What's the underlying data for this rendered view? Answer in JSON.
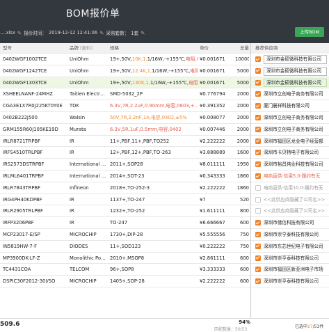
{
  "app": {
    "title": "BOM报价单",
    "file": "….xlsx",
    "time_label": "报价时间：",
    "time_value": "2019-12-12 12:41:06",
    "qty_label": "采购套数：",
    "qty_value": "1套",
    "upload": "上传BOM"
  },
  "table": {
    "headers": [
      "型号",
      "品牌",
      "规格",
      "单价",
      "总量"
    ],
    "brand_tag": "[备料]",
    "rows": [
      {
        "part": "0402WGF1002TCE",
        "brand": "UniOhm",
        "spec": [
          [
            "19+,50V,",
            ""
          ],
          [
            "10K,1,",
            ""
          ],
          [
            "1/16W,-+155℃,",
            ""
          ],
          [
            "电阻,0402",
            ""
          ]
        ],
        "price": "¥0.001671",
        "qty": "10000",
        "sel": false
      },
      {
        "part": "0402WGF1242TCE",
        "brand": "UniOhm",
        "spec": [
          [
            "19+,50V,",
            ""
          ],
          [
            "12.4K,1,",
            ""
          ],
          [
            "1/16W,-+155℃,",
            ""
          ],
          [
            "电阻,0402",
            ""
          ]
        ],
        "price": "¥0.001671",
        "qty": "5000",
        "sel": false
      },
      {
        "part": "0402WGF1303TCE",
        "brand": "UniOhm",
        "spec": [
          [
            "19+,50V,",
            ""
          ],
          [
            "130K,1,",
            ""
          ],
          [
            "1/16W,-+155℃,",
            ""
          ],
          [
            "电阻,0402",
            ""
          ]
        ],
        "price": "¥0.001671",
        "qty": "5000",
        "sel": true
      },
      {
        "part": "XSHEELNANF-24MHZ",
        "brand": "Taitien Electr…",
        "spec": [
          [
            "SMD-5032_2P",
            ""
          ]
        ],
        "price": "¥0.776794",
        "qty": "2000",
        "sel": false
      },
      {
        "part": "CGA3E1X7R0J225KT0Y0E",
        "brand": "TDK",
        "spec": [
          [
            "6.3V,7R,2.2uF,0.90mm,电容,0603,+…",
            ""
          ]
        ],
        "price": "¥0.391352",
        "qty": "2000",
        "sel": false
      },
      {
        "part": "0402B222J500",
        "brand": "Walsin",
        "spec": [
          [
            "50V,7R,2.2nF,1A,电容,0402,±5%",
            ""
          ]
        ],
        "price": "¥0.008077",
        "qty": "2000",
        "sel": false
      },
      {
        "part": "GRM155R60J105KE19D",
        "brand": "Murata",
        "spec": [
          [
            "6.3V,5R,1uF,0.5mm,",
            ""
          ],
          [
            "电容,0402",
            ""
          ]
        ],
        "price": "¥0.007446",
        "qty": "2000",
        "sel": false
      },
      {
        "part": "IRLR8721TRPBF",
        "brand": "IR",
        "spec": [
          [
            "11+,PBF,11+,PBF,TO252",
            ""
          ]
        ],
        "price": "¥2.222222",
        "qty": "2000",
        "sel": false
      },
      {
        "part": "IRFS4510TRLPBF",
        "brand": "IR",
        "spec": [
          [
            "12+,PBF,12+,PBF,TO-263",
            ""
          ]
        ],
        "price": "¥3.888889",
        "qty": "1600",
        "sel": false
      },
      {
        "part": "IRS2573DSTRPBF",
        "brand": "International …",
        "spec": [
          [
            "2011+,SOP28",
            ""
          ]
        ],
        "price": "¥8.011111",
        "qty": "1950",
        "sel": false
      },
      {
        "part": "IRLML6401TRPBF",
        "brand": "International …",
        "spec": [
          [
            "2014+,SOT-23",
            ""
          ]
        ],
        "price": "¥0.343333",
        "qty": "1860",
        "sel": false
      },
      {
        "part": "IRLR7843TRPBF",
        "brand": "Infineon",
        "spec": [
          [
            "2018+,TO-252-3",
            ""
          ]
        ],
        "price": "¥2.222222",
        "qty": "1860",
        "sel": false
      },
      {
        "part": "IRG4PH40KDPBF",
        "brand": "IR",
        "spec": [
          [
            "1137+,TO-247",
            ""
          ]
        ],
        "price": "¥7",
        "qty": "520",
        "sel": false
      },
      {
        "part": "IRLR2905TRLPBF",
        "brand": "IR",
        "spec": [
          [
            "1232+,TO-252",
            ""
          ]
        ],
        "price": "¥1.611111",
        "qty": "800",
        "sel": false
      },
      {
        "part": "IRFP3206PBF",
        "brand": "IR",
        "spec": [
          [
            "TO-247",
            ""
          ]
        ],
        "price": "¥6.666667",
        "qty": "600",
        "sel": false
      },
      {
        "part": "MCP23017-E/SP",
        "brand": "MICROCHIP",
        "spec": [
          [
            "1730+,DIP-28",
            ""
          ]
        ],
        "price": "¥5.555556",
        "qty": "750",
        "sel": false
      },
      {
        "part": "IN5819HW-7-F",
        "brand": "DIODES",
        "spec": [
          [
            "11+,SOD123",
            ""
          ]
        ],
        "price": "¥0.222222",
        "qty": "750",
        "sel": false
      },
      {
        "part": "MP3900DK-LF-Z",
        "brand": "Monolithic Po…",
        "spec": [
          [
            "2010+,MSOP8",
            ""
          ]
        ],
        "price": "¥2.861111",
        "qty": "600",
        "sel": false
      },
      {
        "part": "TC4431COA",
        "brand": "TELCOM",
        "spec": [
          [
            "96+,SOP8",
            ""
          ]
        ],
        "price": "¥3.333333",
        "qty": "600",
        "sel": false
      },
      {
        "part": "DSPIC30F2012-30I/SO",
        "brand": "MICROCHIP",
        "spec": [
          [
            "1405+,SOP-28",
            ""
          ]
        ],
        "price": "¥2.222222",
        "qty": "600",
        "sel": false
      }
    ]
  },
  "suppliers": {
    "header": "推荐供应商",
    "rows": [
      {
        "name": "深圳市金硕微科技有限公司",
        "check": true,
        "style": "box"
      },
      {
        "name": "深圳市金硕微科技有限公司",
        "check": true,
        "style": "box"
      },
      {
        "name": "深圳市金硕微科技有限公司",
        "check": true,
        "style": "boxgreen"
      },
      {
        "name": "深圳市立创电子商务有限公司",
        "check": true,
        "style": "plain"
      },
      {
        "name": "厦门晨祥科技有限公司",
        "check": true,
        "style": "plain"
      },
      {
        "name": "深圳市立创电子商务有限公司",
        "check": true,
        "style": "plain"
      },
      {
        "name": "深圳市立创电子商务有限公司",
        "check": true,
        "style": "plain"
      },
      {
        "name": "深圳市福田区龙业电子经营部",
        "check": true,
        "style": "plain"
      },
      {
        "name": "深圳市卡贝特电子有限公司",
        "check": true,
        "style": "plain"
      },
      {
        "name": "深圳市裕昌伟业科技有限公司",
        "check": true,
        "style": "plain"
      },
      {
        "name": "电商直供-信用5.0-履约有无",
        "check": true,
        "style": "warn"
      },
      {
        "name": "电商直供-信用10.0-履约有无",
        "check": false,
        "style": "dim"
      },
      {
        "name": "<<此供应商隐藏了公司名>>",
        "check": false,
        "style": "dim"
      },
      {
        "name": "<<此供应商隐藏了公司名>>",
        "check": false,
        "style": "dim"
      },
      {
        "name": "深圳市佛信科技有限公司",
        "check": true,
        "style": "plain"
      },
      {
        "name": "深圳市崇亨泰科技有限公司",
        "check": true,
        "style": "plain"
      },
      {
        "name": "深圳市东芯世纪电子有限公司",
        "check": true,
        "style": "plain"
      },
      {
        "name": "深圳市崇亨泰科技有限公司",
        "check": true,
        "style": "plain"
      },
      {
        "name": "深圳市福田区新亚洲电子市场",
        "check": true,
        "style": "plain"
      },
      {
        "name": "深圳市崇亨泰科技有限公司",
        "check": true,
        "style": "plain"
      }
    ]
  },
  "footer": {
    "total": "509.6",
    "pct": "94%",
    "count": "匹配数量：50/53",
    "selected_prefix": "已选中",
    "selected_num": "27",
    "selected_suffix": "/53件"
  }
}
